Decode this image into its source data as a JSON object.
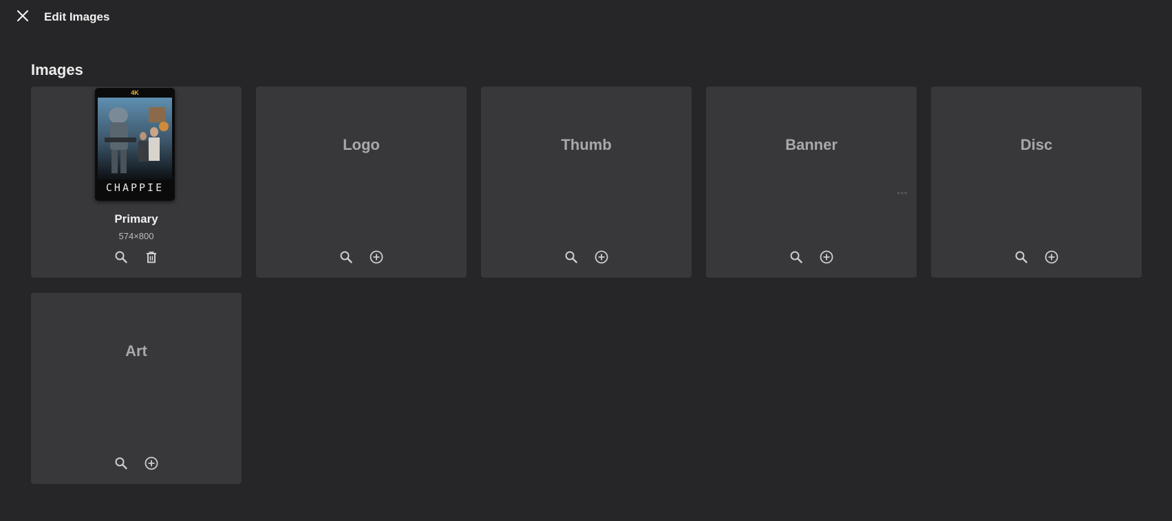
{
  "header": {
    "title": "Edit Images",
    "close_icon": "close-icon"
  },
  "section": {
    "title": "Images"
  },
  "primary": {
    "name": "Primary",
    "size": "574×800",
    "poster_title": "CHAPPIE",
    "poster_badge": "4K"
  },
  "cards": {
    "logo": "Logo",
    "thumb": "Thumb",
    "banner": "Banner",
    "disc": "Disc",
    "art": "Art",
    "banner_more": "•••"
  },
  "icons": {
    "search": "search-icon",
    "add": "add-circle-icon",
    "delete": "trash-icon"
  },
  "colors": {
    "background": "#262628",
    "card": "#38383b",
    "label": "#a9a9ab",
    "icon": "#cfcfcf"
  }
}
